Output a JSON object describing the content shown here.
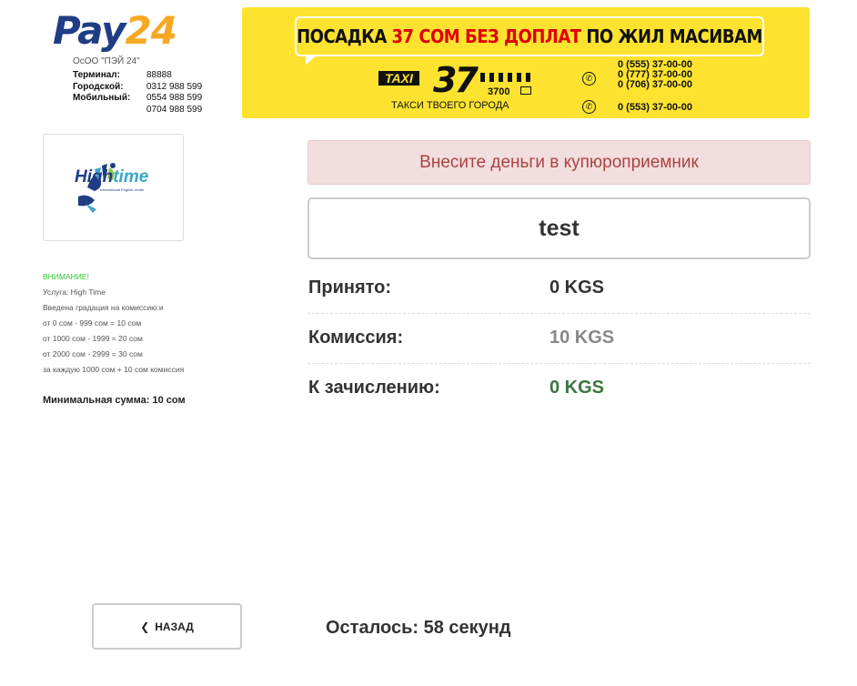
{
  "brand": {
    "logo_part1": "Pay",
    "logo_part2": "24",
    "company": "ОсОО \"ПЭЙ 24\"",
    "contacts": [
      {
        "label": "Терминал:",
        "value": "88888"
      },
      {
        "label": "Городской:",
        "value": "0312 988 599"
      },
      {
        "label": "Мобильный:",
        "value": "0554 988 599"
      },
      {
        "label": "",
        "value": "0704 988 599"
      }
    ],
    "colors": {
      "pay": "#1f3c84",
      "num": "#f7a823"
    }
  },
  "banner": {
    "headline_part1": "ПОСАДКА ",
    "headline_red": "37 СОМ БЕЗ ДОПЛАТ",
    "headline_part2": " ПО ЖИЛ МАСИВАМ",
    "taxi_word": "TAXI",
    "taxi_number": "37",
    "taxi_code": "3700",
    "slogan": "ТАКСИ ТВОЕГО ГОРОДА",
    "phones": [
      "0 (555) 37-00-00",
      "0 (777) 37-00-00",
      "0 (706) 37-00-00"
    ],
    "whatsapp_phone": "0 (553) 37-00-00",
    "colors": {
      "background": "#fde32f",
      "accent": "#e00000"
    }
  },
  "service": {
    "logo_high": "High",
    "logo_time": "time",
    "logo_sub": "International English center"
  },
  "notice": {
    "warning": "ВНИМАНИЕ!",
    "lines": [
      "Услуга: High Time",
      "Введена градация на комиссию:и",
      "от 0 сом - 999 сом = 10 сом",
      "от 1000 сом - 1999 = 20 сом",
      "от 2000 сом - 2999 = 30 сом",
      "за каждую 1000 сом + 10 сом комиссия"
    ],
    "min_sum": "Минимальная сумма: 10 сом"
  },
  "main": {
    "alert": "Внесите деньги в купюроприемник",
    "account": "test",
    "summary": [
      {
        "label": "Принято:",
        "value": "0 KGS",
        "tone": "default"
      },
      {
        "label": "Комиссия:",
        "value": "10 KGS",
        "tone": "gray"
      },
      {
        "label": "К зачислению:",
        "value": "0 KGS",
        "tone": "green"
      }
    ]
  },
  "footer": {
    "back_label": "НАЗАД",
    "timer": "Осталось: 58 секунд"
  }
}
